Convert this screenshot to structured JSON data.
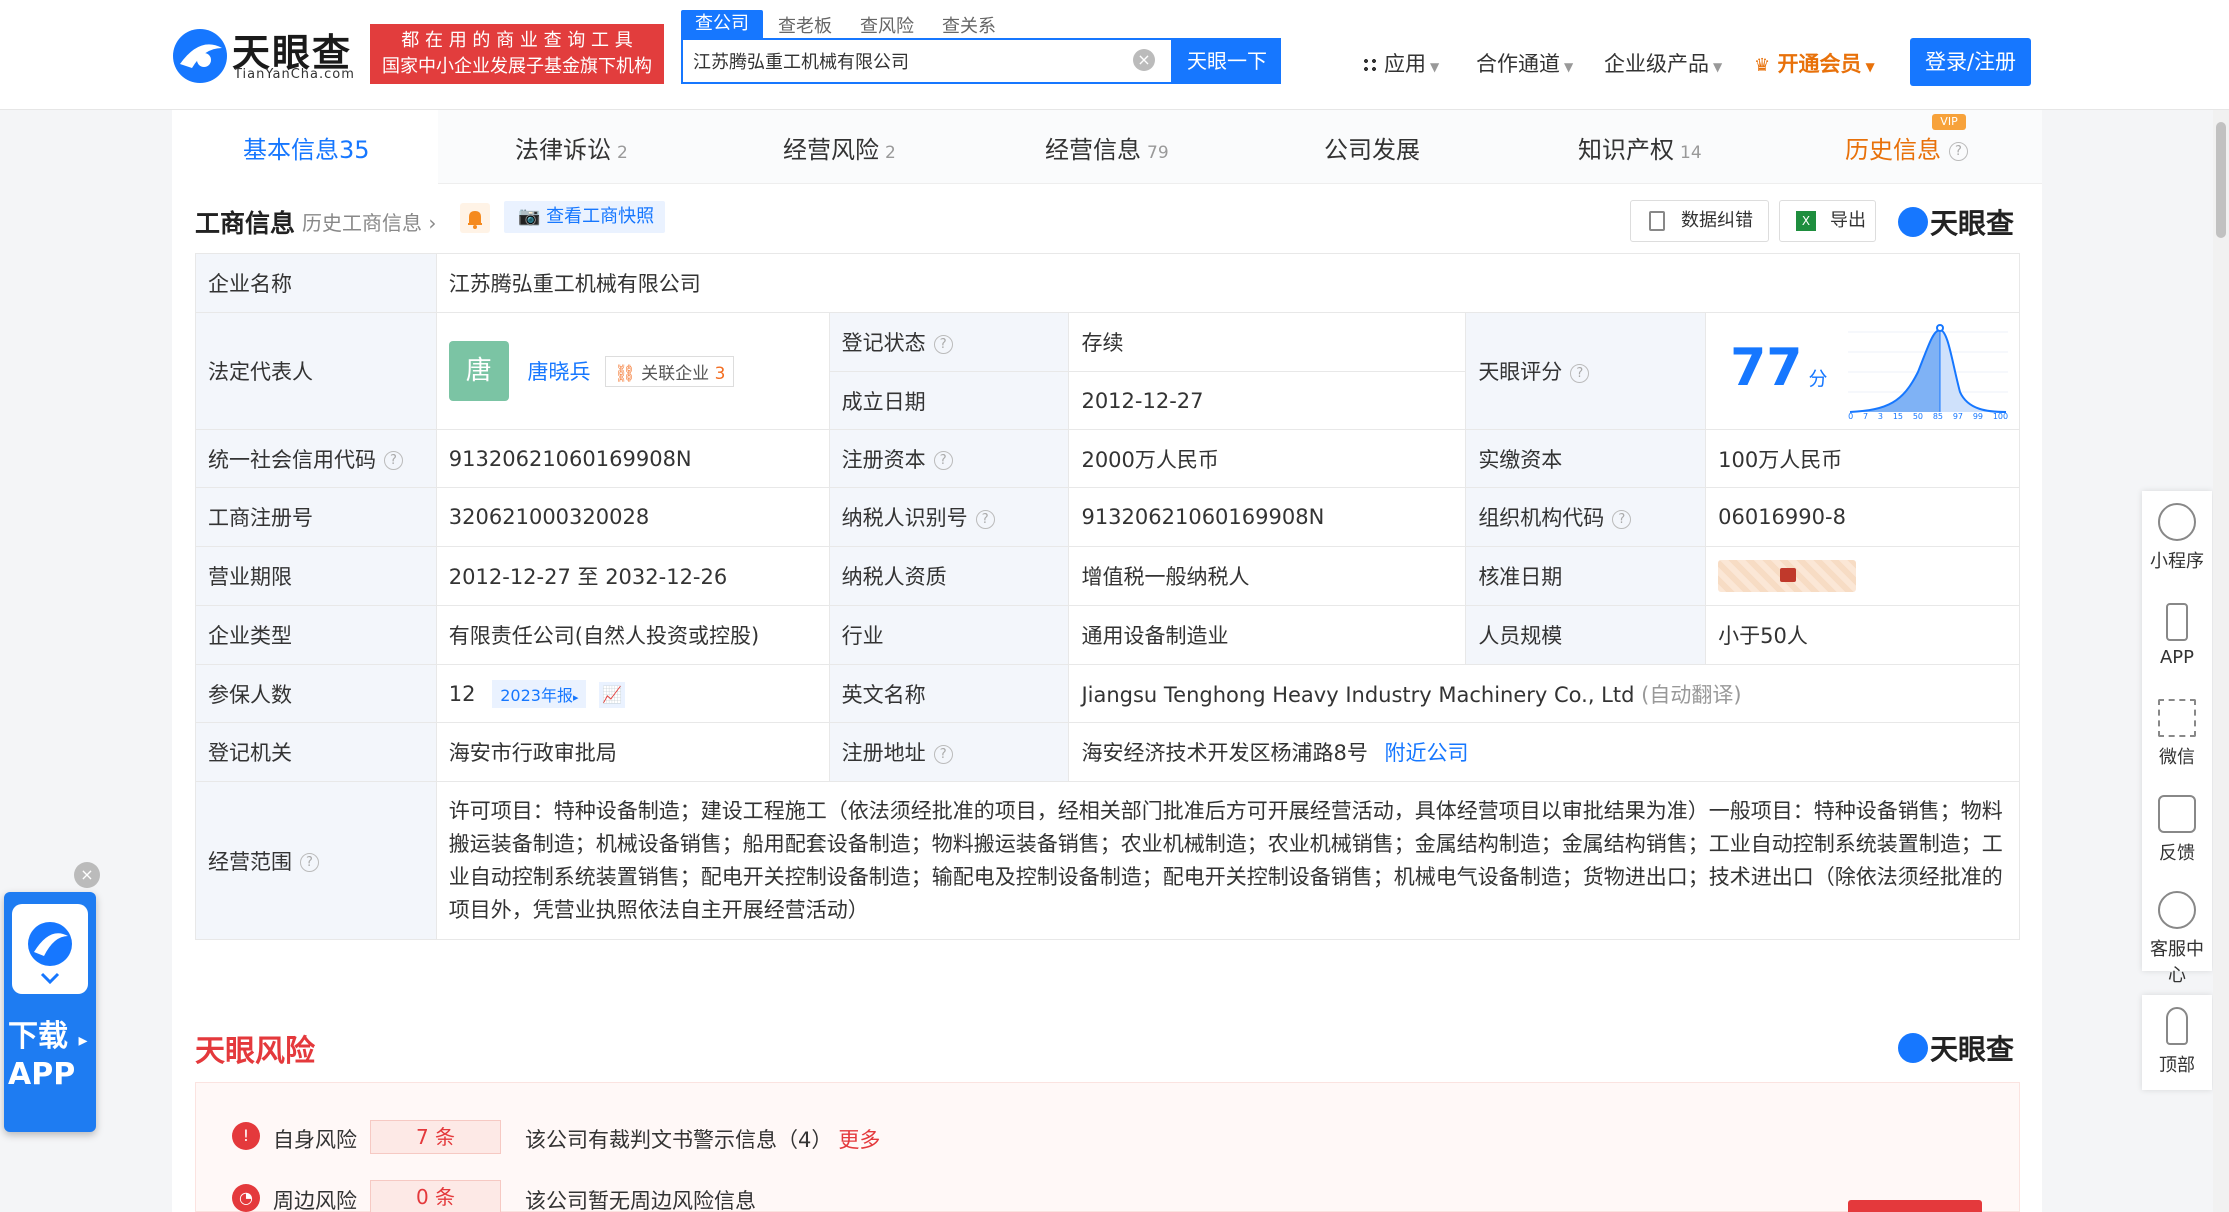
{
  "header": {
    "logo_text": "天眼查",
    "logo_sub": "TianYanCha.com",
    "slogan_line1": "都 在 用 的 商 业 查 询 工 具",
    "slogan_line2": "国家中小企业发展子基金旗下机构",
    "search_tabs": [
      "查公司",
      "查老板",
      "查风险",
      "查关系"
    ],
    "search_value": "江苏腾弘重工机械有限公司",
    "search_button": "天眼一下",
    "nav": [
      "应用",
      "合作通道",
      "企业级产品",
      "开通会员"
    ],
    "login": "登录/注册"
  },
  "tabs": [
    {
      "label": "基本信息",
      "count": "35"
    },
    {
      "label": "法律诉讼",
      "count": "2"
    },
    {
      "label": "经营风险",
      "count": "2"
    },
    {
      "label": "经营信息",
      "count": "79"
    },
    {
      "label": "公司发展",
      "count": ""
    },
    {
      "label": "知识产权",
      "count": "14"
    },
    {
      "label": "历史信息",
      "count": ""
    }
  ],
  "vip_badge": "VIP",
  "section": {
    "title": "工商信息",
    "history_link": "历史工商信息",
    "snapshot": "查看工商快照",
    "correct": "数据纠错",
    "export": "导出",
    "brand": "天眼查"
  },
  "info": {
    "company_name_label": "企业名称",
    "company_name": "江苏腾弘重工机械有限公司",
    "legal_rep_label": "法定代表人",
    "avatar_char": "唐",
    "legal_rep": "唐晓兵",
    "related_label": "关联企业",
    "related_count": "3",
    "reg_status_label": "登记状态",
    "reg_status": "存续",
    "est_date_label": "成立日期",
    "est_date": "2012-12-27",
    "score_label": "天眼评分",
    "score": "77",
    "score_unit": "分",
    "score_ticks": [
      "0",
      "7",
      "3",
      "15",
      "50",
      "85",
      "97",
      "99",
      "100"
    ],
    "credit_code_label": "统一社会信用代码",
    "credit_code": "91320621060169908N",
    "reg_capital_label": "注册资本",
    "reg_capital": "2000万人民币",
    "paid_capital_label": "实缴资本",
    "paid_capital": "100万人民币",
    "reg_no_label": "工商注册号",
    "reg_no": "320621000320028",
    "tax_id_label": "纳税人识别号",
    "tax_id": "91320621060169908N",
    "org_code_label": "组织机构代码",
    "org_code": "06016990-8",
    "term_label": "营业期限",
    "term": "2012-12-27 至 2032-12-26",
    "taxpayer_label": "纳税人资质",
    "taxpayer": "增值税一般纳税人",
    "approve_label": "核准日期",
    "type_label": "企业类型",
    "type": "有限责任公司(自然人投资或控股)",
    "industry_label": "行业",
    "industry": "通用设备制造业",
    "staff_label": "人员规模",
    "staff": "小于50人",
    "insured_label": "参保人数",
    "insured": "12",
    "report_tag": "2023年报",
    "english_label": "英文名称",
    "english": "Jiangsu Tenghong Heavy Industry Machinery Co., Ltd",
    "auto_translate": "(自动翻译)",
    "authority_label": "登记机关",
    "authority": "海安市行政审批局",
    "address_label": "注册地址",
    "address": "海安经济技术开发区杨浦路8号",
    "nearby": "附近公司",
    "scope_label": "经营范围",
    "scope": "许可项目：特种设备制造；建设工程施工（依法须经批准的项目，经相关部门批准后方可开展经营活动，具体经营项目以审批结果为准）一般项目：特种设备销售；物料搬运装备制造；机械设备销售；船用配套设备制造；物料搬运装备销售；农业机械制造；农业机械销售；金属结构制造；金属结构销售；工业自动控制系统装置制造；工业自动控制系统装置销售；配电开关控制设备制造；输配电及控制设备制造；配电开关控制设备销售；机械电气设备制造；货物进出口；技术进出口（除依法须经批准的项目外，凭营业执照依法自主开展经营活动）"
  },
  "risk": {
    "title": "天眼风险",
    "brand": "天眼查",
    "self_label": "自身风险",
    "self_count": "7 条",
    "self_desc": "该公司有裁判文书警示信息（4）",
    "self_more": "更多",
    "around_label": "周边风险",
    "around_count": "0 条",
    "around_desc": "该公司暂无周边风险信息"
  },
  "sidebar": [
    "小程序",
    "APP",
    "微信",
    "反馈",
    "客服中心",
    "顶部"
  ],
  "download": {
    "line1": "下载",
    "line2": "APP"
  },
  "colors": {
    "accent": "#1677ff",
    "danger": "#e4393c",
    "slogan": "#e23d3d"
  }
}
